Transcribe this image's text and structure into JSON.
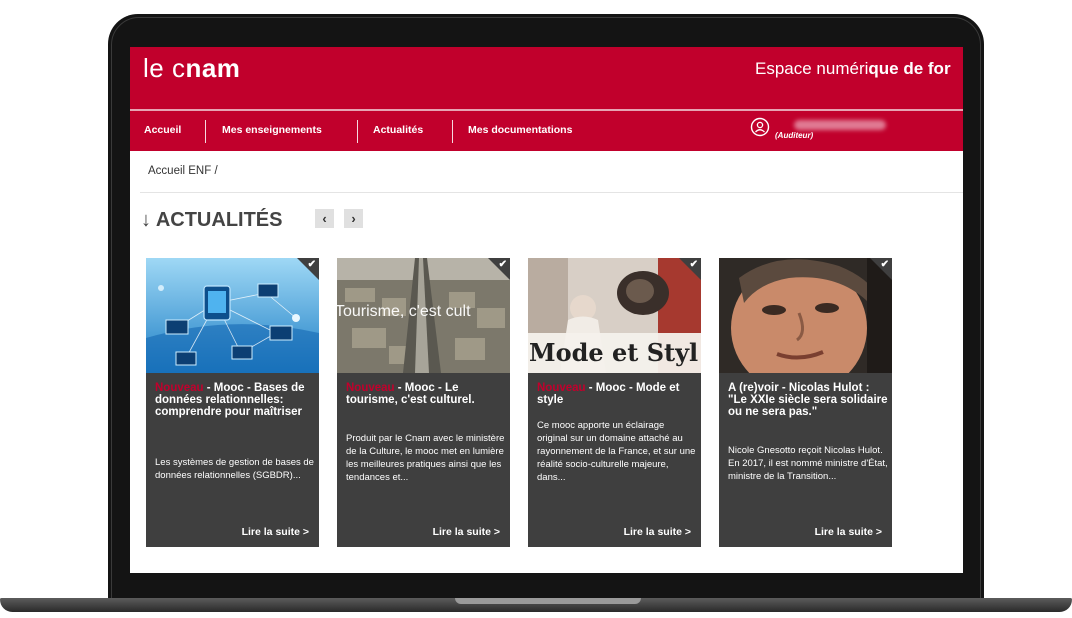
{
  "header": {
    "logo_light": "le c",
    "logo_bold": "nam",
    "espace_light": "Espace numéri",
    "espace_bold": "que de for"
  },
  "nav": {
    "items": [
      {
        "label": "Accueil"
      },
      {
        "label": "Mes enseignements"
      },
      {
        "label": "Actualités"
      },
      {
        "label": "Mes documentations"
      }
    ],
    "user_role": "(Auditeur)"
  },
  "breadcrumb": "Accueil ENF /",
  "section": {
    "arrow": "↓",
    "title": "ACTUALITÉS",
    "prev": "‹",
    "next": "›"
  },
  "cards": [
    {
      "tag": "Nouveau",
      "title": " - Mooc - Bases de données relationnelles: comprendre pour maîtriser",
      "desc": "Les systèmes de gestion de bases de données relationnelles (SGBDR)...",
      "more": "Lire la suite >"
    },
    {
      "tag": "Nouveau",
      "title": " - Mooc - Le tourisme, c'est culturel.",
      "desc": "Produit par le Cnam avec le ministère de la Culture, le mooc met en lumière les meilleures pratiques ainsi que les tendances et...",
      "more": "Lire la suite >",
      "image_text": "Tourisme, c'est cult"
    },
    {
      "tag": "Nouveau",
      "title": " - Mooc - Mode et style",
      "desc": "Ce mooc apporte un éclairage original sur un domaine attaché au rayonnement de la France, et sur une réalité socio-culturelle majeure, dans...",
      "more": "Lire la suite >",
      "image_text": "Mode et Styl"
    },
    {
      "tag": "",
      "title": "A (re)voir - Nicolas Hulot : \"Le XXIe siècle sera solidaire ou ne sera pas.\"",
      "desc": "Nicole Gnesotto reçoit Nicolas Hulot. En 2017, il est nommé ministre d'État, ministre de la Transition...",
      "more": "Lire la suite >"
    }
  ],
  "colors": {
    "brand_red": "#c1002c",
    "card_bg": "#3f3f3f"
  }
}
